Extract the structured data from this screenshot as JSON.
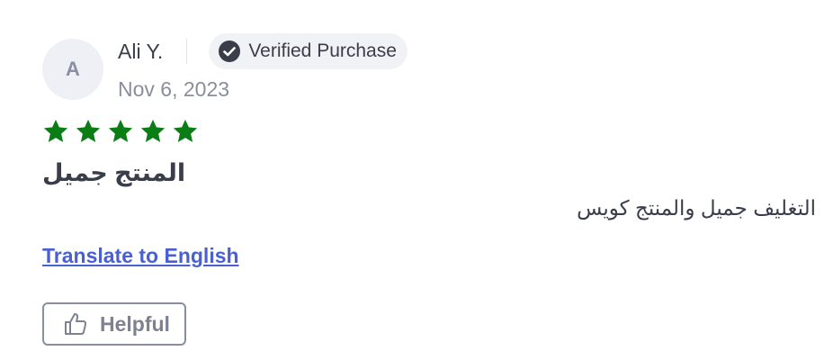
{
  "review": {
    "avatar_initial": "A",
    "reviewer_name": "Ali Y.",
    "verified_label": "Verified Purchase",
    "date": "Nov 6, 2023",
    "rating": 5,
    "rating_max": 5,
    "title": "المنتج جميل",
    "body": "التغليف جميل والمنتج كويس",
    "translate_link": "Translate to English",
    "helpful_label": "Helpful"
  },
  "colors": {
    "star": "#0a7d14",
    "link": "#4960d4",
    "badge_bg": "#f1f2f6",
    "avatar_bg": "#eef0f6"
  },
  "icons": {
    "verified": "check-circle-icon",
    "star": "star-icon",
    "helpful": "thumbs-up-icon"
  }
}
